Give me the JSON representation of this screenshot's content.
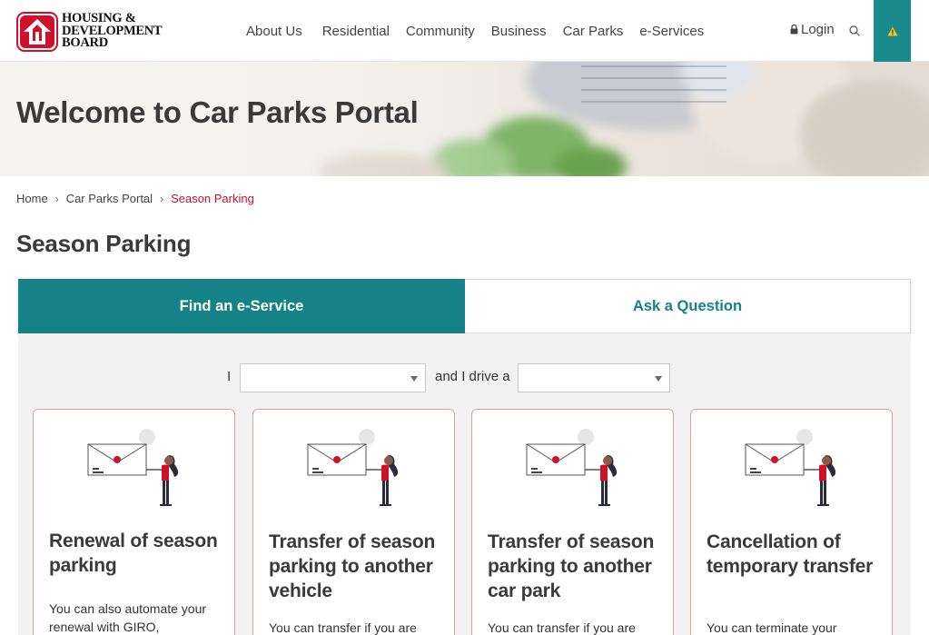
{
  "header": {
    "logo_lines": [
      "HOUSING &",
      "DEVELOPMENT",
      "BOARD"
    ],
    "nav": [
      "About Us",
      "Residential",
      "Community",
      "Business",
      "Car Parks",
      "e-Services"
    ],
    "login": "Login"
  },
  "hero": {
    "title": "Welcome to Car Parks Portal"
  },
  "breadcrumb": {
    "items": [
      "Home",
      "Car Parks Portal",
      "Season Parking"
    ]
  },
  "page_title": "Season Parking",
  "tabs": {
    "active": "Find an e-Service",
    "inactive": "Ask a Question"
  },
  "filter": {
    "label_1": "I",
    "label_2": "and I drive a",
    "select_1_value": "",
    "select_2_value": ""
  },
  "cards": [
    {
      "title": "Renewal of season parking",
      "desc": "You can also automate your renewal with GIRO,"
    },
    {
      "title": "Transfer of season parking to another vehicle",
      "desc": "You can transfer if you are"
    },
    {
      "title": "Transfer of season parking to another car park",
      "desc": "You can transfer if you are"
    },
    {
      "title": "Cancellation of temporary transfer",
      "desc": "You can terminate your"
    }
  ],
  "colors": {
    "teal": "#148287",
    "red": "#c8102e",
    "card_border": "#d9a3a3"
  },
  "icons": {
    "login": "lock-icon",
    "search": "search-icon",
    "alert": "warning-icon",
    "breadcrumb_sep": "chevron-right-icon"
  }
}
